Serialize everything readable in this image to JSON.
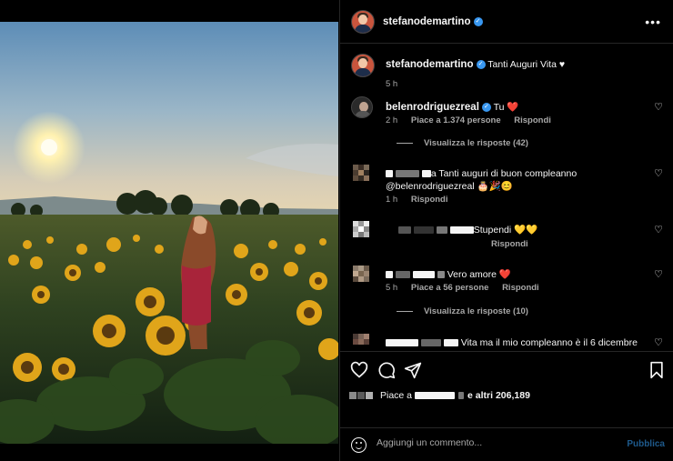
{
  "post": {
    "username": "stefanodemartino",
    "more_icon": "more-horizontal-icon"
  },
  "caption": {
    "username": "stefanodemartino",
    "text": "Tanti Auguri Vita ♥",
    "time": "5 h"
  },
  "comments": [
    {
      "username": "belenrodriguezreal",
      "text": "Tu ❤️",
      "time": "2 h",
      "likes": "Piace a 1.374 persone",
      "reply": "Rispondi",
      "view_replies": "Visualizza le risposte (42)"
    },
    {
      "text_a": "a Tanti auguri di buon compleanno",
      "text_b": "@belenrodriguezreal 🎂🎉😊",
      "time": "1 h",
      "reply": "Rispondi"
    },
    {
      "text": "Stupendi 💛💛",
      "reply": "Rispondi"
    },
    {
      "text": "Vero amore ❤️",
      "time": "5 h",
      "likes": "Piace a 56 persone",
      "reply": "Rispondi",
      "view_replies": "Visualizza le risposte (10)"
    },
    {
      "text": "Vita ma il mio compleanno è il 6 dicembre"
    }
  ],
  "likes_line": {
    "prefix": "Piace a",
    "suffix": "e altri 206,189"
  },
  "add_comment": {
    "placeholder": "Aggiungi un commento...",
    "publish": "Pubblica"
  },
  "colors": {
    "background": "#000000",
    "divider": "#262626",
    "muted": "#a8a8a8",
    "verified": "#3897f0",
    "publish": "#1e5a8c",
    "heart": "#ed4956"
  }
}
